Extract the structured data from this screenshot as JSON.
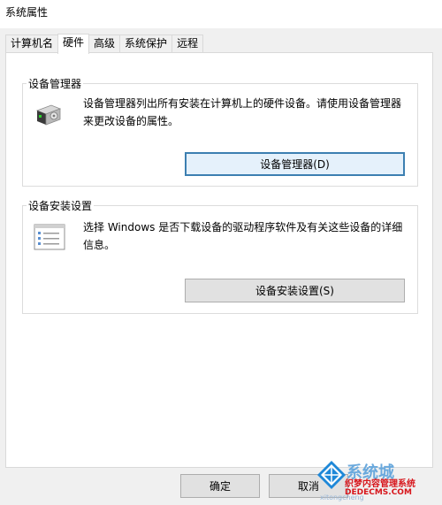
{
  "window": {
    "title": "系统属性"
  },
  "tabs": [
    {
      "label": "计算机名",
      "active": false
    },
    {
      "label": "硬件",
      "active": true
    },
    {
      "label": "高级",
      "active": false
    },
    {
      "label": "系统保护",
      "active": false
    },
    {
      "label": "远程",
      "active": false
    }
  ],
  "device_manager": {
    "group_label": "设备管理器",
    "description": "设备管理器列出所有安装在计算机上的硬件设备。请使用设备管理器来更改设备的属性。",
    "button_label": "设备管理器(D)",
    "icon": "device-manager-icon"
  },
  "device_install": {
    "group_label": "设备安装设置",
    "description": "选择 Windows 是否下载设备的驱动程序软件及有关这些设备的详细信息。",
    "button_label": "设备安装设置(S)",
    "icon": "checklist-icon"
  },
  "footer": {
    "ok_label": "确定",
    "cancel_label": "取消"
  },
  "watermark": {
    "brand": "系统城",
    "tagline": "织梦内容管理系统",
    "url": "DEDECMS.COM",
    "under_text": "xitongcheng"
  },
  "colors": {
    "window_bg": "#f0f0f0",
    "panel_bg": "#ffffff",
    "button_bg": "#e1e1e1",
    "focus_border": "#3c7fb1"
  }
}
